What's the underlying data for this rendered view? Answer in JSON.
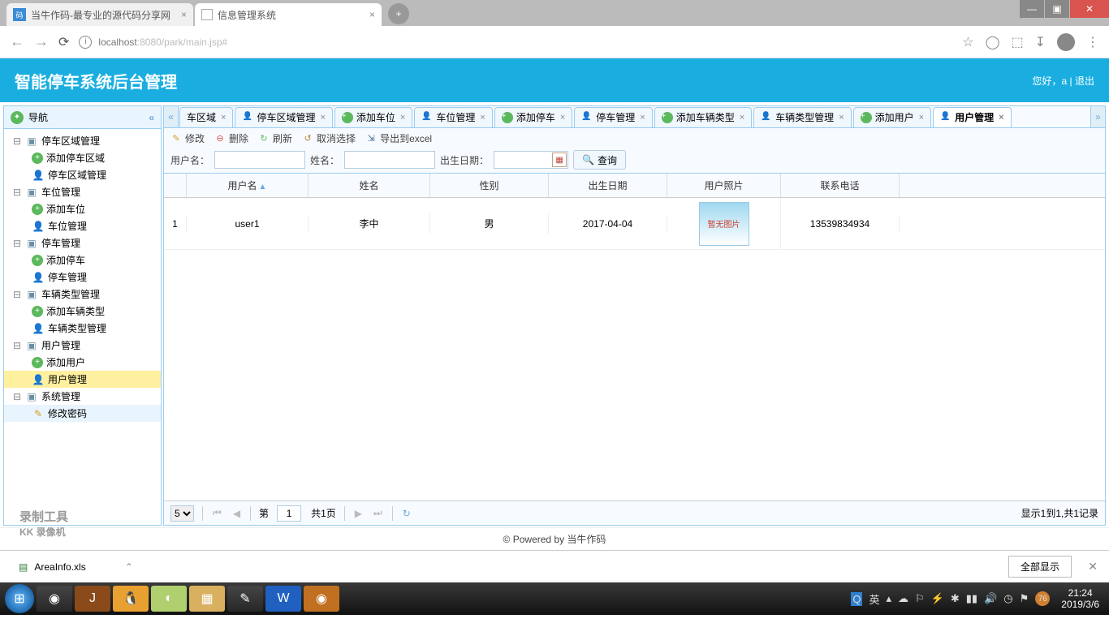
{
  "browser": {
    "tabs": [
      {
        "title": "当牛作码-最专业的源代码分享网"
      },
      {
        "title": "信息管理系统"
      }
    ],
    "url_host": "localhost",
    "url_port": ":8080",
    "url_path": "/park/main.jsp#"
  },
  "app": {
    "title": "智能停车系统后台管理",
    "greeting_prefix": "您好，",
    "username": "a",
    "logout": "退出"
  },
  "sidebar": {
    "title": "导航",
    "nodes": [
      {
        "label": "停车区域管理",
        "depth": 0,
        "icon": "folder",
        "toggle": "−"
      },
      {
        "label": "添加停车区域",
        "depth": 1,
        "icon": "add"
      },
      {
        "label": "停车区域管理",
        "depth": 1,
        "icon": "user"
      },
      {
        "label": "车位管理",
        "depth": 0,
        "icon": "folder",
        "toggle": "−"
      },
      {
        "label": "添加车位",
        "depth": 1,
        "icon": "add"
      },
      {
        "label": "车位管理",
        "depth": 1,
        "icon": "user"
      },
      {
        "label": "停车管理",
        "depth": 0,
        "icon": "folder",
        "toggle": "−"
      },
      {
        "label": "添加停车",
        "depth": 1,
        "icon": "add"
      },
      {
        "label": "停车管理",
        "depth": 1,
        "icon": "user"
      },
      {
        "label": "车辆类型管理",
        "depth": 0,
        "icon": "folder",
        "toggle": "−"
      },
      {
        "label": "添加车辆类型",
        "depth": 1,
        "icon": "add"
      },
      {
        "label": "车辆类型管理",
        "depth": 1,
        "icon": "user"
      },
      {
        "label": "用户管理",
        "depth": 0,
        "icon": "folder",
        "toggle": "−"
      },
      {
        "label": "添加用户",
        "depth": 1,
        "icon": "add"
      },
      {
        "label": "用户管理",
        "depth": 1,
        "icon": "user",
        "selected": true
      },
      {
        "label": "系统管理",
        "depth": 0,
        "icon": "folder",
        "toggle": "−"
      },
      {
        "label": "修改密码",
        "depth": 1,
        "icon": "edit",
        "hover": true
      }
    ]
  },
  "tabs": [
    {
      "label": "车区域",
      "icon": "",
      "partial": true
    },
    {
      "label": "停车区域管理",
      "icon": "user"
    },
    {
      "label": "添加车位",
      "icon": "add"
    },
    {
      "label": "车位管理",
      "icon": "user"
    },
    {
      "label": "添加停车",
      "icon": "add"
    },
    {
      "label": "停车管理",
      "icon": "user"
    },
    {
      "label": "添加车辆类型",
      "icon": "add"
    },
    {
      "label": "车辆类型管理",
      "icon": "user"
    },
    {
      "label": "添加用户",
      "icon": "add"
    },
    {
      "label": "用户管理",
      "icon": "user",
      "active": true
    }
  ],
  "toolbar": {
    "edit": "修改",
    "delete": "删除",
    "refresh": "刷新",
    "cancel_sel": "取消选择",
    "export": "导出到excel",
    "search": {
      "user_label": "用户名：",
      "name_label": "姓名：",
      "date_label": "出生日期：",
      "search_btn": "查询"
    }
  },
  "grid": {
    "columns": {
      "user": "用户名",
      "name": "姓名",
      "sex": "性别",
      "date": "出生日期",
      "photo": "用户照片",
      "phone": "联系电话"
    },
    "rows": [
      {
        "idx": "1",
        "user": "user1",
        "name": "李中",
        "sex": "男",
        "date": "2017-04-04",
        "photo": "暂无图片",
        "phone": "13539834934"
      }
    ]
  },
  "pager": {
    "page_size": "5",
    "page_prefix": "第",
    "page_value": "1",
    "page_total": "共1页",
    "record_info": "显示1到1,共1记录"
  },
  "footer": {
    "text": "© Powered by 当牛作码"
  },
  "download": {
    "file": "AreaInfo.xls",
    "show_all": "全部显示"
  },
  "watermark": {
    "line1": "录制工具",
    "line2": "KK 录像机"
  },
  "clock": {
    "time": "21:24",
    "date": "2019/3/6"
  }
}
